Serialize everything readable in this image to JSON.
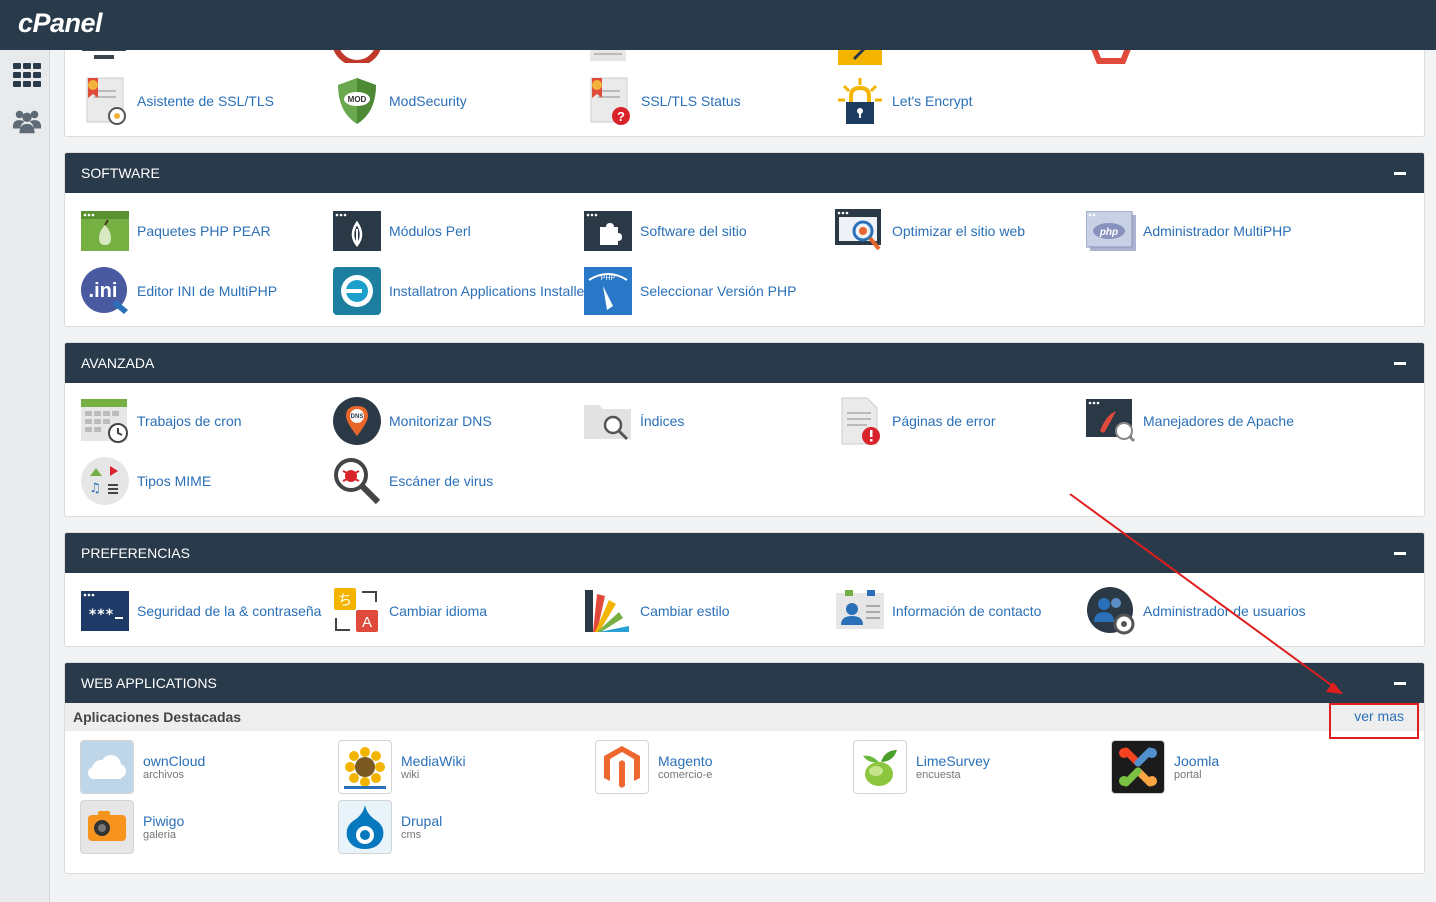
{
  "app": {
    "logo": "cPanel"
  },
  "leftnav": {
    "items": [
      {
        "icon": "grid-icon"
      },
      {
        "icon": "users-icon"
      }
    ]
  },
  "security": {
    "items": [
      {
        "label": "Asistente de SSL/TLS",
        "icon": "ssl-wizard-icon"
      },
      {
        "label": "ModSecurity",
        "icon": "modsecurity-icon"
      },
      {
        "label": "SSL/TLS Status",
        "icon": "ssl-status-icon"
      },
      {
        "label": "Let's Encrypt",
        "icon": "lets-encrypt-icon"
      }
    ]
  },
  "software": {
    "title": "SOFTWARE",
    "items": [
      {
        "label": "Paquetes PHP PEAR",
        "icon": "php-pear-icon"
      },
      {
        "label": "Módulos Perl",
        "icon": "perl-modules-icon"
      },
      {
        "label": "Software del sitio",
        "icon": "site-software-icon"
      },
      {
        "label": "Optimizar el sitio web",
        "icon": "optimize-website-icon"
      },
      {
        "label": "Administrador MultiPHP",
        "icon": "multiphp-manager-icon"
      },
      {
        "label": "Editor INI de MultiPHP",
        "icon": "ini-editor-icon"
      },
      {
        "label": "Installatron Applications Installer",
        "icon": "installatron-icon"
      },
      {
        "label": "Seleccionar Versión PHP",
        "icon": "php-version-icon"
      }
    ]
  },
  "advanced": {
    "title": "AVANZADA",
    "items": [
      {
        "label": "Trabajos de cron",
        "icon": "cron-jobs-icon"
      },
      {
        "label": "Monitorizar DNS",
        "icon": "dns-monitor-icon"
      },
      {
        "label": "Índices",
        "icon": "indexes-icon"
      },
      {
        "label": "Páginas de error",
        "icon": "error-pages-icon"
      },
      {
        "label": "Manejadores de Apache",
        "icon": "apache-handlers-icon"
      },
      {
        "label": "Tipos MIME",
        "icon": "mime-types-icon"
      },
      {
        "label": "Escáner de virus",
        "icon": "virus-scanner-icon"
      }
    ]
  },
  "preferences": {
    "title": "PREFERENCIAS",
    "items": [
      {
        "label": "Seguridad de la & contraseña",
        "icon": "password-icon"
      },
      {
        "label": "Cambiar idioma",
        "icon": "language-icon"
      },
      {
        "label": "Cambiar estilo",
        "icon": "style-icon"
      },
      {
        "label": "Información de contacto",
        "icon": "contact-info-icon"
      },
      {
        "label": "Administrador de usuarios",
        "icon": "user-manager-icon"
      }
    ]
  },
  "webapps": {
    "title": "WEB APPLICATIONS",
    "featured_title": "Aplicaciones Destacadas",
    "more_label": "ver mas",
    "apps": [
      {
        "name": "ownCloud",
        "category": "archivos",
        "icon": "owncloud-icon"
      },
      {
        "name": "MediaWiki",
        "category": "wiki",
        "icon": "mediawiki-icon"
      },
      {
        "name": "Magento",
        "category": "comercio-e",
        "icon": "magento-icon"
      },
      {
        "name": "LimeSurvey",
        "category": "encuesta",
        "icon": "limesurvey-icon"
      },
      {
        "name": "Joomla",
        "category": "portal",
        "icon": "joomla-icon"
      },
      {
        "name": "Piwigo",
        "category": "galeria",
        "icon": "piwigo-icon"
      },
      {
        "name": "Drupal",
        "category": "cms",
        "icon": "drupal-icon"
      }
    ]
  },
  "annotation": {
    "color": "#e01e1e"
  }
}
